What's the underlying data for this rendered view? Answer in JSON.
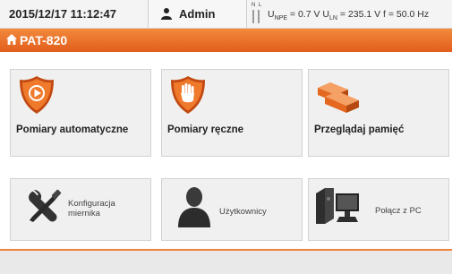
{
  "status_bar": {
    "datetime": "2015/12/17 11:12:47",
    "user": "Admin",
    "nl_indicator": "N L",
    "measurements": {
      "unpe_label": "U",
      "unpe_sub": "NPE",
      "unpe_value": " = 0.7 V ",
      "uln_label": "U",
      "uln_sub": "LN",
      "uln_value": " = 235.1 V ",
      "f_value": "f = 50.0 Hz"
    }
  },
  "title_bar": {
    "title": "PAT-820"
  },
  "tiles": {
    "auto": {
      "label": "Pomiary automatyczne",
      "icon": "shield-play-icon"
    },
    "manual": {
      "label": "Pomiary ręczne",
      "icon": "shield-hand-icon"
    },
    "memory": {
      "label": "Przeglądaj pamięć",
      "icon": "memory-blocks-icon"
    },
    "config": {
      "label_line1": "Konfiguracja",
      "label_line2": "miernika",
      "icon": "tools-icon"
    },
    "users": {
      "label": "Użytkownicy",
      "icon": "user-silhouette-icon"
    },
    "pc": {
      "label": "Połącz z PC",
      "icon": "computer-icon"
    }
  },
  "colors": {
    "accent": "#e8661f",
    "tile_bg": "#f0f0f0",
    "icon_gray": "#2f2f2f"
  }
}
